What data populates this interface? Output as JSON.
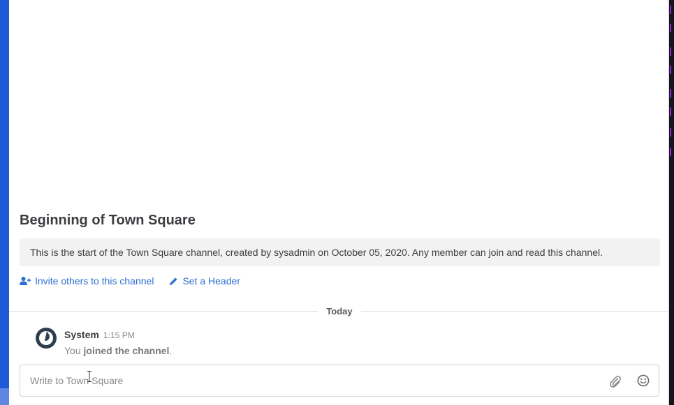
{
  "channel": {
    "intro_title": "Beginning of Town Square",
    "intro_text": "This is the start of the Town Square channel, created by sysadmin on October 05, 2020. Any member can join and read this channel.",
    "actions": {
      "invite_label": "Invite others to this channel",
      "header_label": "Set a Header"
    }
  },
  "date_separator": "Today",
  "post": {
    "author": "System",
    "time": "1:15 PM",
    "body_prefix": "You",
    "body_bold": "joined the channel",
    "body_suffix": "."
  },
  "composer": {
    "placeholder": "Write to Town Square",
    "value": ""
  },
  "icons": {
    "invite": "user-plus-icon",
    "header": "pencil-icon",
    "avatar": "mattermost-logo",
    "attach": "paperclip-icon",
    "emoji": "smiley-icon"
  },
  "colors": {
    "sidebar": "#1e59d6",
    "link": "#2d6fd3",
    "intro_bg": "#f2f2f2"
  }
}
